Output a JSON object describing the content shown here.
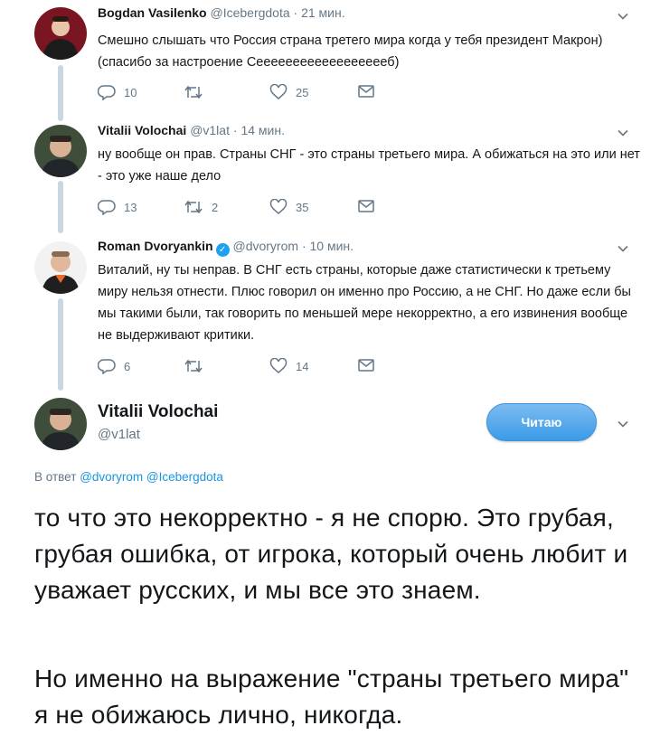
{
  "tweets": [
    {
      "name": "Bogdan Vasilenko",
      "handle": "@Icebergdota",
      "sep": "·",
      "time": "21 мин.",
      "text": "Смешно слышать что Россия страна третего мира когда у тебя президент Макрон) (спасибо за настроение Сееееееееееееееееееб)",
      "replies": "10",
      "retweets": "",
      "likes": "25"
    },
    {
      "name": "Vitalii Volochai",
      "handle": "@v1lat",
      "sep": "·",
      "time": "14 мин.",
      "text": "ну вообще он прав. Страны СНГ - это страны третьего мира. А обижаться на это или нет - это уже наше дело",
      "replies": "13",
      "retweets": "2",
      "likes": "35"
    },
    {
      "name": "Roman Dvoryankin",
      "handle": "@dvoryrom",
      "sep": "·",
      "time": "10 мин.",
      "text": "Виталий, ну ты неправ. В СНГ есть страны, которые даже статистически к третьему миру нельзя отнести. Плюс говорил он именно про Россию, а не СНГ. Но даже если бы мы такими были, так говорить по меньшей мере некорректно, а его извинения вообще не выдерживают критики.",
      "replies": "6",
      "retweets": "",
      "likes": "14"
    }
  ],
  "main_tweet": {
    "name": "Vitalii Volochai",
    "handle": "@v1lat",
    "follow_label": "Читаю",
    "reply_prefix": "В ответ",
    "mention_1": "@dvoryrom",
    "mention_2": "@Icebergdota",
    "paragraph_1": "то что это некорректно - я не спорю. Это грубая, грубая ошибка, от игрока, который очень любит и уважает русских, и мы все это знаем.",
    "paragraph_2": "Но именно на выражение \"страны третьего мира\" я не обижаюсь лично, никогда."
  },
  "icons": {
    "reply": "reply-icon",
    "retweet": "retweet-icon",
    "like": "heart-icon",
    "dm": "mail-icon",
    "caret": "chevron-down-icon",
    "verified": "verified-badge-icon"
  },
  "colors": {
    "text": "#14171a",
    "secondary": "#657786",
    "link": "#1b95e0",
    "thread": "#c9d7e1",
    "button": "#3b9be8"
  }
}
